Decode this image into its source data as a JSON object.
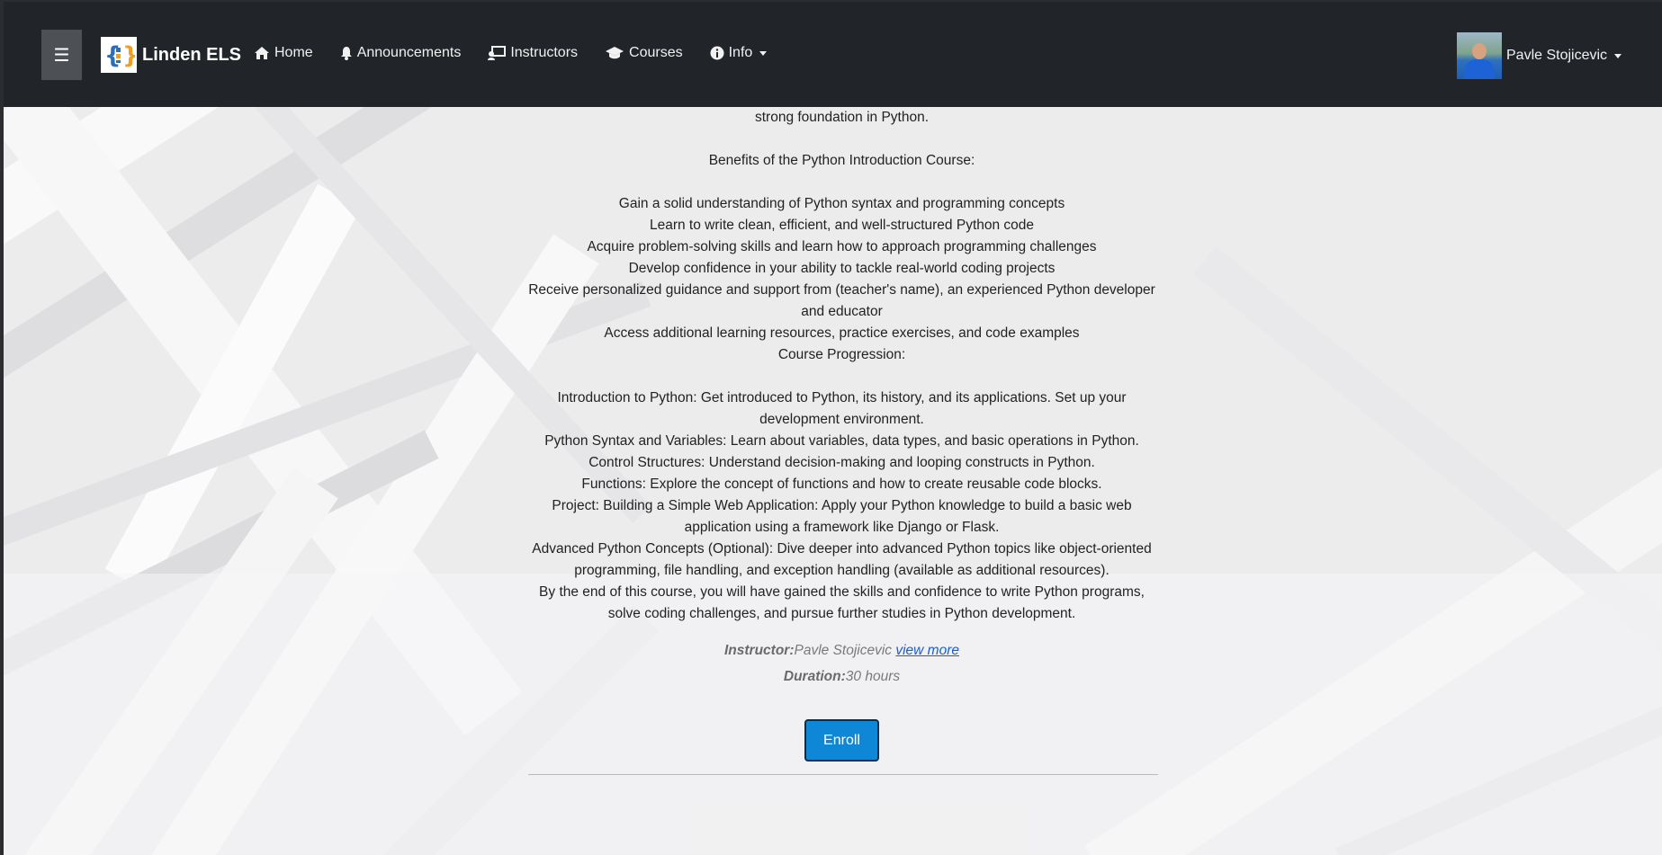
{
  "navbar": {
    "menu_icon": "☰",
    "brand_name": "Linden ELS",
    "links": [
      {
        "label": "Home",
        "icon": "home-icon"
      },
      {
        "label": "Announcements",
        "icon": "bell-icon"
      },
      {
        "label": "Instructors",
        "icon": "teacher-icon"
      },
      {
        "label": "Courses",
        "icon": "graduation-cap-icon"
      },
      {
        "label": "Info",
        "icon": "info-icon"
      }
    ],
    "user_name": "Pavle Stojicevic"
  },
  "course": {
    "lines": [
      "strong foundation in Python.",
      "",
      "Benefits of the Python Introduction Course:",
      "",
      "Gain a solid understanding of Python syntax and programming concepts",
      "Learn to write clean, efficient, and well-structured Python code",
      "Acquire problem-solving skills and learn how to approach programming challenges",
      "Develop confidence in your ability to tackle real-world coding projects",
      "Receive personalized guidance and support from (teacher's name), an experienced Python developer and educator",
      "Access additional learning resources, practice exercises, and code examples",
      "Course Progression:",
      "",
      "Introduction to Python: Get introduced to Python, its history, and its applications. Set up your development environment.",
      "Python Syntax and Variables: Learn about variables, data types, and basic operations in Python.",
      "Control Structures: Understand decision-making and looping constructs in Python.",
      "Functions: Explore the concept of functions and how to create reusable code blocks.",
      "Project: Building a Simple Web Application: Apply your Python knowledge to build a basic web application using a framework like Django or Flask.",
      "Advanced Python Concepts (Optional): Dive deeper into advanced Python topics like object-oriented programming, file handling, and exception handling (available as additional resources).",
      "By the end of this course, you will have gained the skills and confidence to write Python programs, solve coding challenges, and pursue further studies in Python development."
    ],
    "instructor_label": "Instructor:",
    "instructor_name": "Pavle Stojicevic",
    "view_more": "view more",
    "duration_label": "Duration:",
    "duration_value": "30 hours",
    "enroll_label": "Enroll"
  },
  "colors": {
    "navbar_bg": "#212529",
    "enroll_bg": "#0d87d6",
    "link": "#1a5fc8"
  }
}
